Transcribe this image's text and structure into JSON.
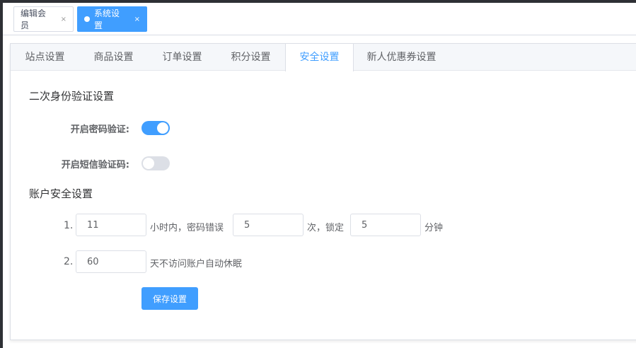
{
  "page_tabs": [
    {
      "label": "编辑会员",
      "close": "×"
    },
    {
      "label": "系统设置",
      "close": "×"
    }
  ],
  "settings_tabs": [
    "站点设置",
    "商品设置",
    "订单设置",
    "积分设置",
    "安全设置",
    "新人优惠券设置"
  ],
  "active_settings_tab": "安全设置",
  "second_auth": {
    "title": "二次身份验证设置",
    "password_label": "开启密码验证:",
    "password_enabled": true,
    "sms_label": "开启短信验证码:",
    "sms_enabled": false
  },
  "account_security": {
    "title": "账户安全设置",
    "rule1": {
      "index": "1.",
      "hours": "11",
      "text1": "小时内，密码错误",
      "times": "5",
      "text2": "次，锁定",
      "minutes": "5",
      "text3": "分钟"
    },
    "rule2": {
      "index": "2.",
      "days": "60",
      "text1": "天不访问账户自动休眠"
    },
    "save_label": "保存设置"
  },
  "colors": {
    "accent": "#409eff",
    "switch_off": "#dcdfe6"
  }
}
